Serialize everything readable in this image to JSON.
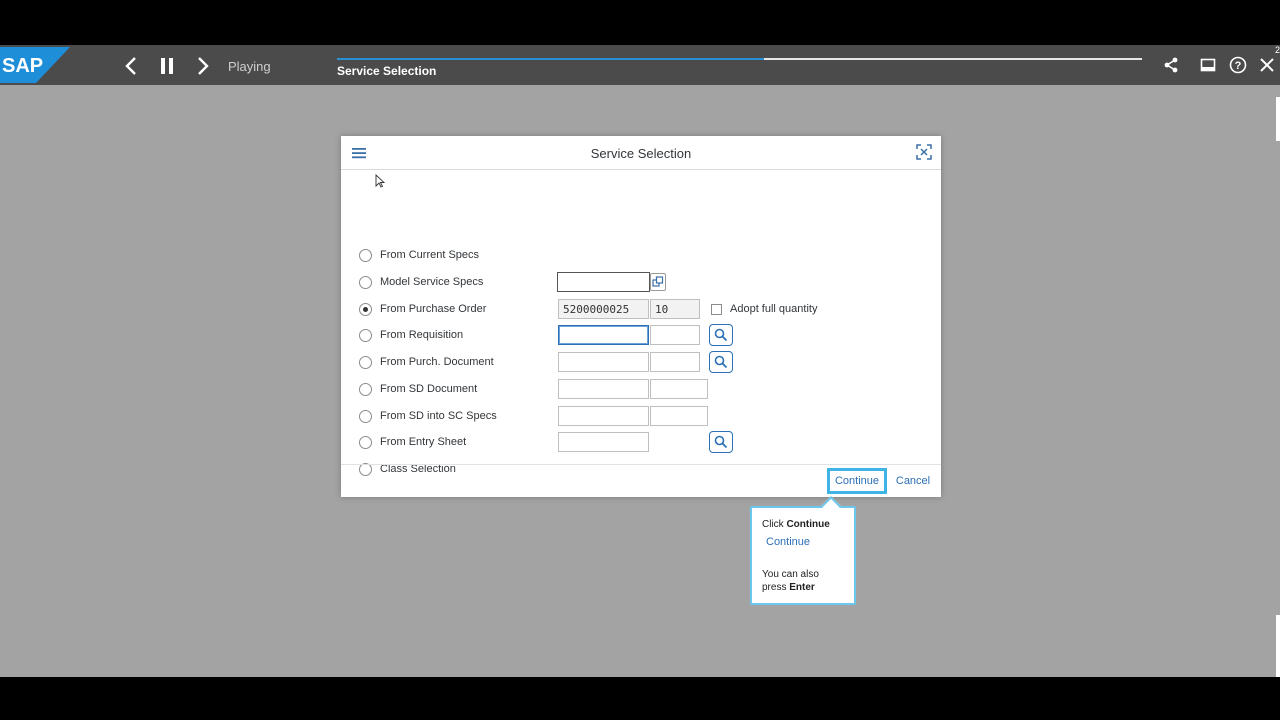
{
  "player": {
    "logo_text": "SAP",
    "status": "Playing",
    "step_title": "Service Selection",
    "progress_percent": 53,
    "corner_mark": "2",
    "icons": [
      "back-icon",
      "pause-icon",
      "forward-icon",
      "share-icon",
      "window-icon",
      "help-icon",
      "close-icon"
    ]
  },
  "dialog": {
    "title": "Service Selection",
    "options": [
      {
        "label": "From Current Specs",
        "checked": false
      },
      {
        "label": "Model Service Specs",
        "checked": false
      },
      {
        "label": "From Purchase Order",
        "checked": true
      },
      {
        "label": "From Requisition",
        "checked": false
      },
      {
        "label": "From Purch. Document",
        "checked": false
      },
      {
        "label": "From SD Document",
        "checked": false
      },
      {
        "label": "From SD into SC Specs",
        "checked": false
      },
      {
        "label": "From Entry Sheet",
        "checked": false
      },
      {
        "label": "Class Selection",
        "checked": false
      }
    ],
    "fields": {
      "purchase_order_number": "5200000025",
      "purchase_order_item": "10"
    },
    "adopt_full_quantity_label": "Adopt full quantity",
    "continue_label": "Continue",
    "cancel_label": "Cancel"
  },
  "tooltip": {
    "click_prefix": "Click ",
    "click_target": "Continue",
    "link_label": "Continue",
    "hint_line1": "You can also",
    "hint_prefix": "press ",
    "hint_key": "Enter"
  },
  "colors": {
    "accent": "#41b4e6",
    "link": "#2b6fb6",
    "toolbar": "#4b4b4b",
    "backdrop": "#a3a3a3",
    "sap_blue": "#1f8ed8"
  }
}
